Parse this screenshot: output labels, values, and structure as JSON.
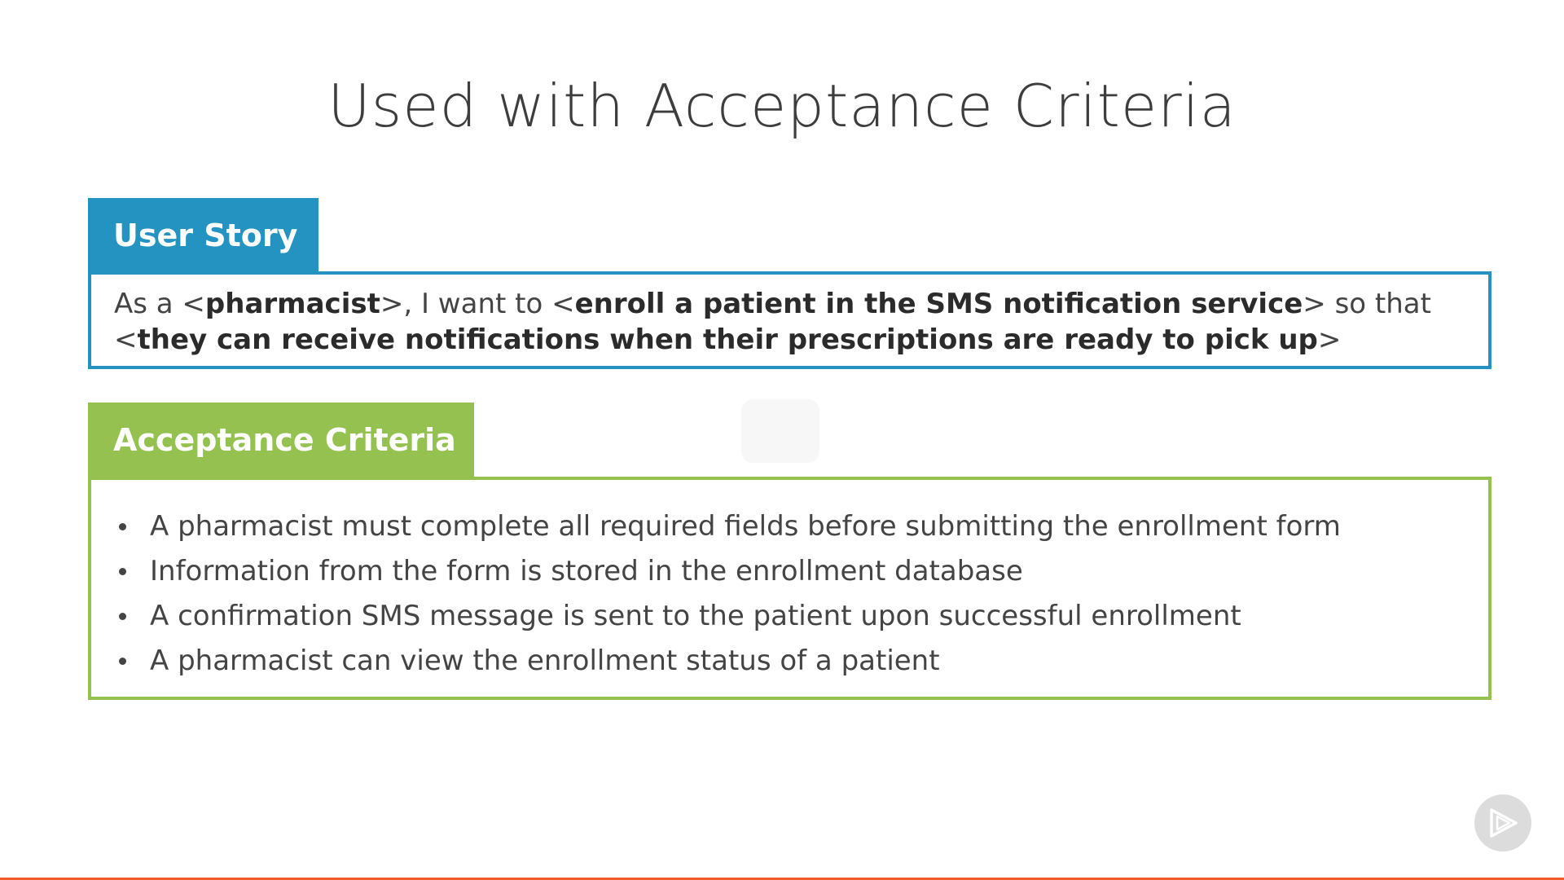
{
  "slide": {
    "title": "Used with Acceptance Criteria"
  },
  "user_story": {
    "label": "User Story",
    "color": "#2493c1",
    "parts": {
      "p1": "As a <",
      "role": "pharmacist",
      "p2": ">, I want to <",
      "goal": "enroll a patient in the SMS notification service",
      "p3": "> so that",
      "p4": "<",
      "benefit": "they can receive notifications when their prescriptions are ready to pick up",
      "p5": ">"
    }
  },
  "acceptance_criteria": {
    "label": "Acceptance Criteria",
    "color": "#94c150",
    "items": [
      "A pharmacist must complete all required fields before submitting the enrollment form",
      "Information from the form is stored in the enrollment database",
      "A confirmation SMS message is sent to the patient upon successful enrollment",
      "A pharmacist can view the enrollment status of a patient"
    ]
  },
  "player": {
    "play_icon": "play-icon",
    "progress_color": "#f15b2a"
  }
}
